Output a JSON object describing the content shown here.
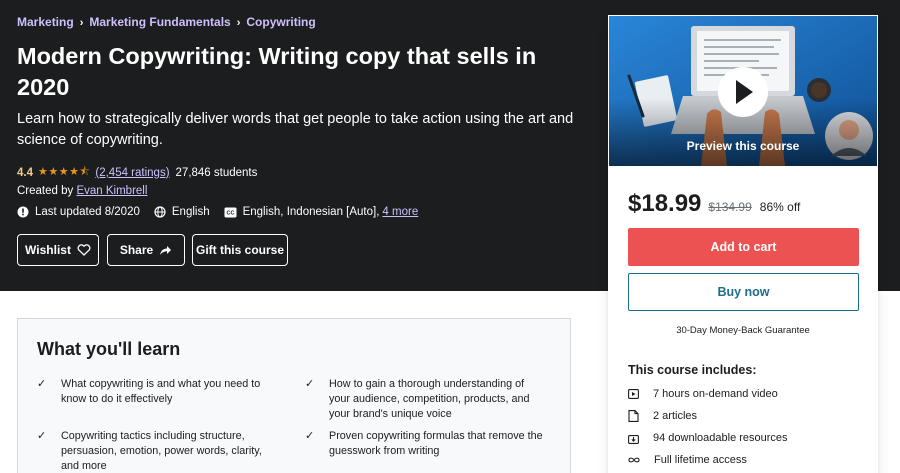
{
  "breadcrumb": {
    "items": [
      "Marketing",
      "Marketing Fundamentals",
      "Copywriting"
    ]
  },
  "course": {
    "title": "Modern Copywriting: Writing copy that sells in 2020",
    "subtitle": "Learn how to strategically deliver words that get people to take action using the art and science of copywriting.",
    "rating": "4.4",
    "stars": "★★★★⯪",
    "ratings_count": "(2,454 ratings)",
    "students": "27,846 students",
    "created_by_label": "Created by",
    "instructor": "Evan Kimbrell",
    "last_updated": "Last updated 8/2020",
    "language": "English",
    "captions": "English, Indonesian [Auto],",
    "captions_more": "4 more"
  },
  "actions": {
    "wishlist": "Wishlist",
    "share": "Share",
    "gift": "Gift this course"
  },
  "sidebar": {
    "preview_label": "Preview this course",
    "price": "$18.99",
    "original_price": "$134.99",
    "discount": "86% off",
    "add_to_cart": "Add to cart",
    "buy_now": "Buy now",
    "guarantee": "30-Day Money-Back Guarantee",
    "includes_title": "This course includes:",
    "includes": [
      {
        "icon": "video-icon",
        "text": "7 hours on-demand video"
      },
      {
        "icon": "file-icon",
        "text": "2 articles"
      },
      {
        "icon": "download-icon",
        "text": "94 downloadable resources"
      },
      {
        "icon": "infinity-icon",
        "text": "Full lifetime access"
      }
    ]
  },
  "learn": {
    "title": "What you'll learn",
    "items": [
      "What copywriting is and what you need to know to do it effectively",
      "How to gain a thorough understanding of your audience, competition, products, and your brand's unique voice",
      "Copywriting tactics including structure, persuasion, emotion, power words, clarity, and more",
      "Proven copywriting formulas that remove the guesswork from writing"
    ]
  },
  "colors": {
    "hero_bg": "#1c1d1f",
    "link_purple": "#cec0fc",
    "rating_gold": "#f3ca8c",
    "cart_red": "#ec5252",
    "buy_teal": "#1c6e8c"
  }
}
